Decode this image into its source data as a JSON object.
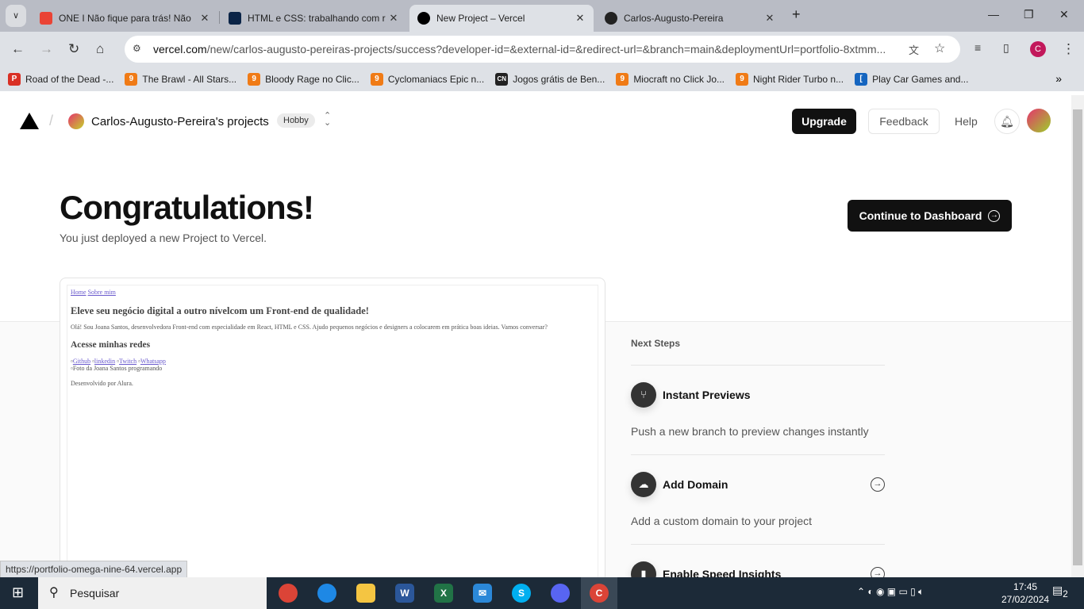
{
  "browser": {
    "tabs": [
      {
        "title": "ONE I Não fique para trás! Não",
        "color": "#ea4335"
      },
      {
        "title": "HTML e CSS: trabalhando com r",
        "color": "#0b2447"
      },
      {
        "title": "New Project – Vercel",
        "color": "#000000"
      },
      {
        "title": "Carlos-Augusto-Pereira",
        "color": "#222222"
      }
    ],
    "url_domain": "vercel.com",
    "url_path": "/new/carlos-augusto-pereiras-projects/success?developer-id=&external-id=&redirect-url=&branch=main&deploymentUrl=portfolio-8xtmm...",
    "profile_initial": "C",
    "bookmarks": [
      {
        "label": "Road of the Dead -...",
        "icon": "P",
        "color": "#d93025"
      },
      {
        "label": "The Brawl - All Stars...",
        "icon": "9",
        "color": "#f07b16"
      },
      {
        "label": "Bloody Rage no Clic...",
        "icon": "9",
        "color": "#f07b16"
      },
      {
        "label": "Cyclomaniacs Epic n...",
        "icon": "9",
        "color": "#f07b16"
      },
      {
        "label": "Jogos grátis de Ben...",
        "icon": "CN",
        "color": "#222222"
      },
      {
        "label": "Miocraft no Click Jo...",
        "icon": "9",
        "color": "#f07b16"
      },
      {
        "label": "Night Rider Turbo n...",
        "icon": "9",
        "color": "#f07b16"
      },
      {
        "label": "Play Car Games and...",
        "icon": "[",
        "color": "#1565c0"
      }
    ],
    "status_url": "https://portfolio-omega-nine-64.vercel.app"
  },
  "header": {
    "team": "Carlos-Augusto-Pereira's projects",
    "plan": "Hobby",
    "upgrade": "Upgrade",
    "feedback": "Feedback",
    "help": "Help"
  },
  "hero": {
    "title": "Congratulations!",
    "subtitle": "You just deployed a new Project to Vercel.",
    "continue": "Continue to Dashboard"
  },
  "preview": {
    "nav": [
      "Home",
      "Sobre mim"
    ],
    "heading": "Eleve seu negócio digital a outro nívelcom um Front-end de qualidade!",
    "intro": "Olá! Sou Joana Santos, desenvolvedora Front-end com especialidade em React, HTML e CSS. Ajudo pequenos negócios e designers a colocarem em prática boas ideias. Vamos conversar?",
    "social_heading": "Acesse minhas redes",
    "links": [
      "Github",
      "linkedin",
      "Twitch",
      "Whatsapp"
    ],
    "photo_alt": "Foto da Joana Santos programando",
    "footer": "Desenvolvido por Alura."
  },
  "next_steps": {
    "title": "Next Steps",
    "items": [
      {
        "title": "Instant Previews",
        "desc": "Push a new branch to preview changes instantly",
        "icon": "git-branch-icon"
      },
      {
        "title": "Add Domain",
        "desc": "Add a custom domain to your project",
        "icon": "cloud-icon"
      },
      {
        "title": "Enable Speed Insights",
        "desc": "",
        "icon": "chart-icon"
      }
    ]
  },
  "taskbar": {
    "search": "Pesquisar",
    "time": "17:45",
    "date": "27/02/2024",
    "notifications": "2"
  }
}
